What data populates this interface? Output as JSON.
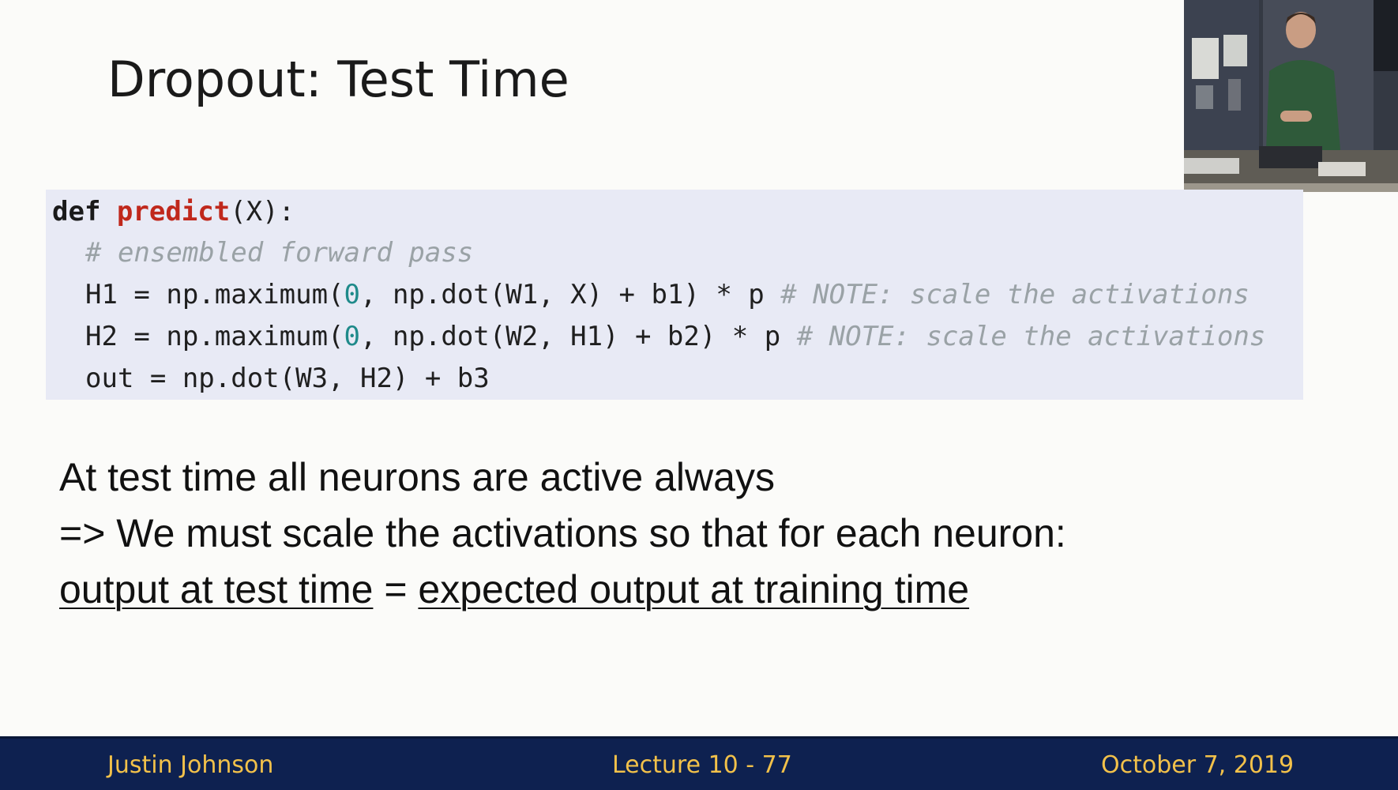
{
  "slide": {
    "title": "Dropout: Test Time"
  },
  "code": {
    "l1_def": "def",
    "l1_fn": "predict",
    "l1_rest": "(X):",
    "l2_comment": "# ensembled forward pass",
    "l3_a": "H1 = np.maximum(",
    "l3_zero": "0",
    "l3_b": ", np.dot(W1, X) + b1) * p ",
    "l3_comment": "# NOTE: scale the activations",
    "l4_a": "H2 = np.maximum(",
    "l4_zero": "0",
    "l4_b": ", np.dot(W2, H1) + b2) * p ",
    "l4_comment": "# NOTE: scale the activations",
    "l5": "out = np.dot(W3, H2) + b3"
  },
  "text": {
    "line1": "At test time all neurons are active always",
    "line2": "=> We must scale the activations so that for each neuron:",
    "line3_a": "output at test time",
    "line3_eq": " = ",
    "line3_b": "expected output at training time"
  },
  "footer": {
    "author": "Justin Johnson",
    "lecture": "Lecture 10 - 77",
    "date": "October 7, 2019"
  },
  "colors": {
    "code_bg": "#e8eaf5",
    "footer_bg": "#0e2150",
    "footer_text": "#f2c14a",
    "function_name": "#c0281c"
  }
}
